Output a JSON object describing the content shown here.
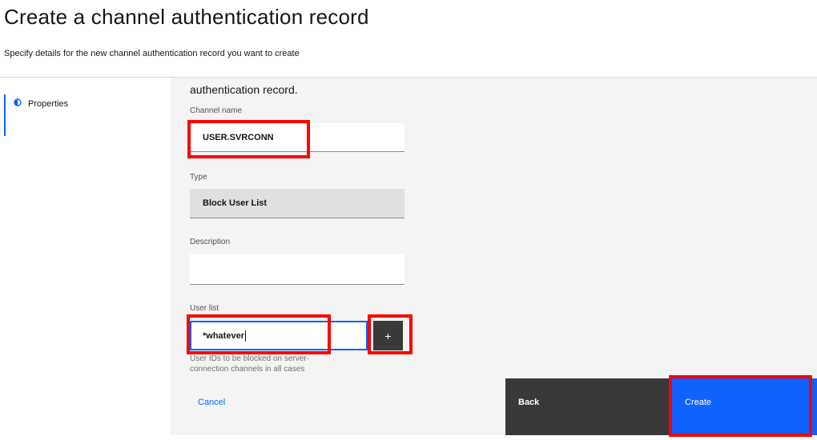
{
  "header": {
    "title": "Create a channel authentication record",
    "subtitle": "Specify details for the new channel authentication record you want to create"
  },
  "nav": {
    "items": [
      {
        "label": "Properties",
        "icon": "half-circle-icon",
        "active": true
      }
    ]
  },
  "form": {
    "intro_text": "authentication record.",
    "channel_name": {
      "label": "Channel name",
      "value": "USER.SVRCONN"
    },
    "type": {
      "label": "Type",
      "value": "Block User List"
    },
    "description": {
      "label": "Description",
      "value": ""
    },
    "user_list": {
      "label": "User list",
      "value": "*whatever",
      "add_label": "+",
      "helper": "User IDs to be blocked on server-connection channels in all cases"
    }
  },
  "footer": {
    "cancel_label": "Cancel",
    "back_label": "Back",
    "create_label": "Create"
  },
  "colors": {
    "accent": "#0f62fe",
    "highlight": "#ff0000",
    "dark_button": "#393939"
  }
}
